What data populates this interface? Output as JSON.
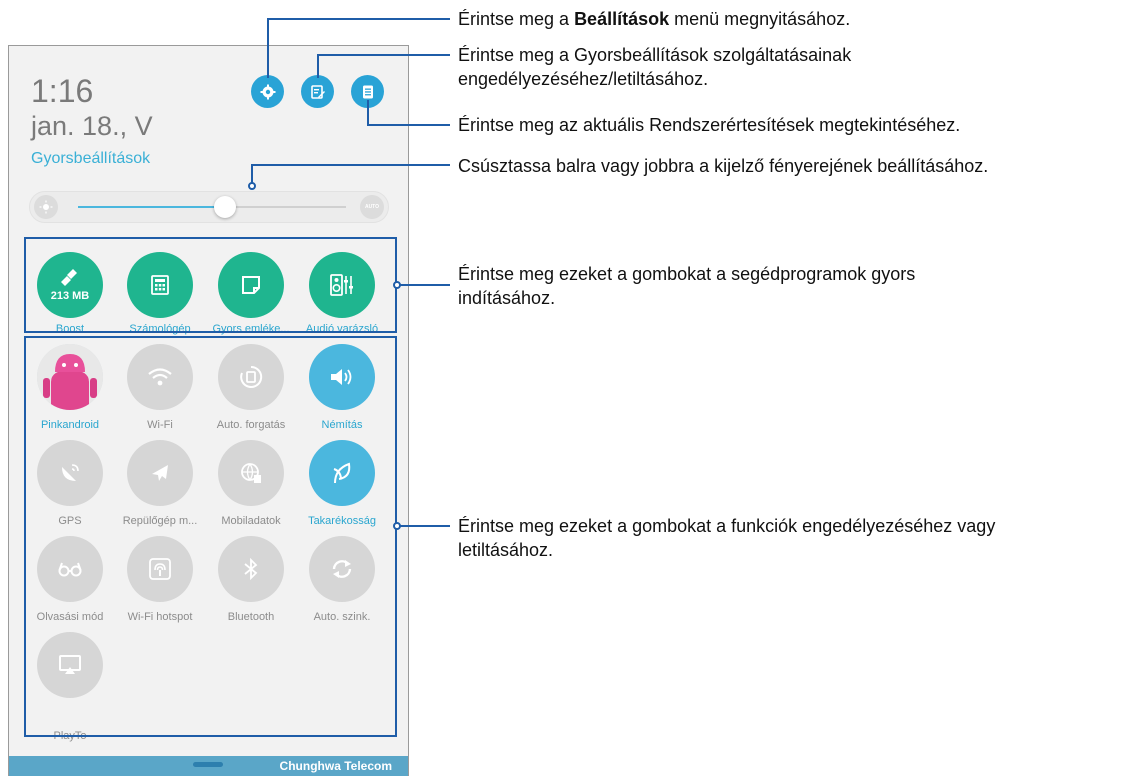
{
  "status": {
    "time": "1:16",
    "date": "jan. 18., V"
  },
  "quick_settings": {
    "title": "Gyorsbeállítások"
  },
  "brightness": {
    "level": 0.55,
    "auto_label": "AUTO"
  },
  "tools": [
    {
      "label": "Boost",
      "sub": "213 MB",
      "icon": "broom-icon"
    },
    {
      "label": "Számológép",
      "icon": "calculator-icon"
    },
    {
      "label": "Gyors emléke...",
      "icon": "note-icon"
    },
    {
      "label": "Audió varázsló",
      "icon": "speaker-icon"
    }
  ],
  "functions": [
    {
      "label": "Pinkandroid",
      "icon": "avatar",
      "on": true
    },
    {
      "label": "Wi-Fi",
      "icon": "wifi-icon",
      "on": false
    },
    {
      "label": "Auto. forgatás",
      "icon": "rotate-icon",
      "on": false
    },
    {
      "label": "Némítás",
      "icon": "mute-icon",
      "on": true
    },
    {
      "label": "GPS",
      "icon": "gps-icon",
      "on": false
    },
    {
      "label": "Repülőgép m...",
      "icon": "airplane-icon",
      "on": false
    },
    {
      "label": "Mobiladatok",
      "icon": "globe-icon",
      "on": false
    },
    {
      "label": "Takarékosság",
      "icon": "leaf-icon",
      "on": true
    },
    {
      "label": "Olvasási mód",
      "icon": "glasses-icon",
      "on": false
    },
    {
      "label": "Wi-Fi hotspot",
      "icon": "hotspot-icon",
      "on": false
    },
    {
      "label": "Bluetooth",
      "icon": "bluetooth-icon",
      "on": false
    },
    {
      "label": "Auto. szink.",
      "icon": "sync-icon",
      "on": false
    },
    {
      "label": "PlayTo",
      "icon": "cast-icon",
      "on": false
    }
  ],
  "carrier": "Chunghwa Telecom",
  "callouts": {
    "settings_pre": "Érintse meg a ",
    "settings_bold": "Beállítások",
    "settings_post": " menü megnyitásához.",
    "qs_line1": "Érintse meg a Gyorsbeállítások szolgáltatásainak",
    "qs_line2": "engedélyezéséhez/letiltásához.",
    "notifications": "Érintse meg az aktuális Rendszerértesítések megtekintéséhez.",
    "brightness": "Csúsztassa balra vagy jobbra a kijelző fényerejének beállításához.",
    "tools_line1": "Érintse meg ezeket a gombokat a segédprogramok gyors",
    "tools_line2": "indításához.",
    "functions_line1": "Érintse meg ezeket a gombokat a funkciók engedélyezéséhez vagy",
    "functions_line2": "letiltásához."
  },
  "colors": {
    "accent": "#29a3d6",
    "tool_green": "#1fb58f",
    "callout_blue": "#1f5da8",
    "bar": "#5aa6c8"
  }
}
